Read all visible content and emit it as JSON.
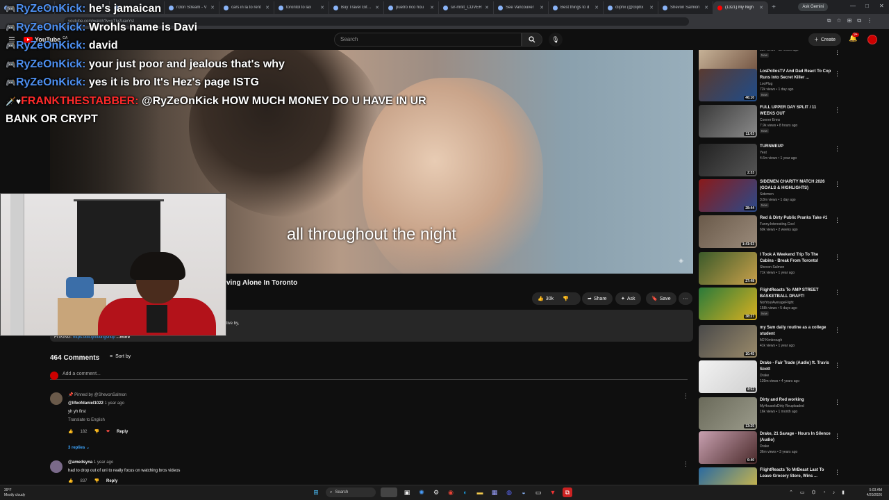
{
  "browser": {
    "tabs": [
      {
        "label": "",
        "active": false
      },
      {
        "label": "",
        "active": false
      },
      {
        "label": "",
        "active": false
      },
      {
        "label": "n3on Stream - V",
        "active": false
      },
      {
        "label": "cars in la to rent",
        "active": false
      },
      {
        "label": "torontol to lax",
        "active": false
      },
      {
        "label": "Buy Travel Gift C",
        "active": false
      },
      {
        "label": "puetro rico hou",
        "active": false
      },
      {
        "label": "sir-mrkt_COVER",
        "active": false
      },
      {
        "label": "See Vancouver",
        "active": false
      },
      {
        "label": "Best things to d",
        "active": false
      },
      {
        "label": "cliphx (@cliphx",
        "active": false
      },
      {
        "label": "Shevon Salmon",
        "active": false
      },
      {
        "label": "(1321) My Nigh",
        "active": true
      }
    ],
    "ask_gemini": "Ask Gemini",
    "url": "youtube.com/watch?v=uTIvZuaxYsl"
  },
  "youtube": {
    "logo_text": "YouTube",
    "country": "CA",
    "search_placeholder": "Search",
    "create_label": "Create",
    "notif_badge": "9+"
  },
  "chat": [
    {
      "user": "RyZeOnKick",
      "message": "he's jamaican",
      "color": "#4d8ff0",
      "prefix": "🎮"
    },
    {
      "user": "RyZeOnKick",
      "message": "Wrohls name is Davi",
      "color": "#4d8ff0",
      "prefix": "🎮"
    },
    {
      "user": "RyZeOnKick",
      "message": "david",
      "color": "#4d8ff0",
      "prefix": "🎮"
    },
    {
      "user": "RyZeOnKick",
      "message": "your just poor and jealous that's why",
      "color": "#4d8ff0",
      "prefix": "🎮"
    },
    {
      "user": "RyZeOnKick",
      "message": "yes it is bro It's Hez's page ISTG",
      "color": "#4d8ff0",
      "prefix": "🎮"
    },
    {
      "user": "FRANKTHESTABBER",
      "message": "@RyZeOnKick HOW MUCH MONEY DO U HAVE IN UR",
      "color": "#ff2a2a",
      "prefix": "🗡️♥"
    },
    {
      "user": "",
      "message": "BANK OR CRYPT",
      "color": "#ffffff",
      "prefix": ""
    }
  ],
  "player": {
    "caption": "all throughout the night"
  },
  "video": {
    "title_partial": "ving Alone In Toronto",
    "likes": "30k",
    "share_label": "Share",
    "ask_label": "Ask",
    "save_label": "Save",
    "desc_partial": "live by,",
    "desc_link_label": "FITKING:",
    "desc_link": "https://bit.ly/fitkingshop",
    "desc_more": "...more"
  },
  "comments": {
    "count_label": "464 Comments",
    "sort_label": "Sort by",
    "add_placeholder": "Add a comment...",
    "items": [
      {
        "pinned": "Pinned by @ShevonSalmon",
        "handle": "@lifeofdaniel1022",
        "time": "1 year ago",
        "body": "yh yh first",
        "translate": "Translate to English",
        "likes": "182",
        "reply": "Reply",
        "replies": "3 replies"
      },
      {
        "pinned": "",
        "handle": "@amedsyna",
        "time": "1 year ago",
        "body": "had to drop out of uni to really focus on watching bros videos",
        "translate": "",
        "likes": "837",
        "reply": "Reply",
        "replies": ""
      }
    ]
  },
  "sidebar": [
    {
      "title": "",
      "channel": "",
      "views": "38k views • 12 hours ago",
      "new": "New",
      "duration": "15:12",
      "thumb": [
        "#c9b59a",
        "#6b4b3a"
      ]
    },
    {
      "title": "LosPollosTV And Dad React To Cop Runs Into Secret Killer ...",
      "channel": "LooPlug",
      "views": "72k views • 1 day ago",
      "new": "New",
      "duration": "46:10",
      "thumb": [
        "#5a3a30",
        "#1e4c8a"
      ]
    },
    {
      "title": "FULL UPPER DAY SPLIT / 11 WEEKS OUT",
      "channel": "Conner Enns",
      "views": "7.9k views • 8 hours ago",
      "new": "New",
      "duration": "11:03",
      "thumb": [
        "#3a3a3a",
        "#8a8a8a"
      ]
    },
    {
      "title": "TURNMEUP",
      "channel": "Yeat",
      "views": "4.6m views • 1 year ago",
      "new": "",
      "duration": "2:33",
      "thumb": [
        "#222222",
        "#555555"
      ]
    },
    {
      "title": "SIDEMEN CHARITY MATCH 2026 (GOALS & HIGHLIGHTS)",
      "channel": "Sidemen",
      "views": "3.8m views • 1 day ago",
      "new": "New",
      "duration": "28:44",
      "thumb": [
        "#8a1a1a",
        "#2a4a8a"
      ]
    },
    {
      "title": "Red & Dirty Public Pranks Take #1",
      "channel": "Funny.Interesting.Cool",
      "views": "60k views • 2 weeks ago",
      "new": "",
      "duration": "1:41:03",
      "thumb": [
        "#6a5a4a",
        "#9a8a7a"
      ]
    },
    {
      "title": "I Took A Weekend Trip To The Cabins - Break From Toronto!",
      "channel": "Shevon Salmon",
      "views": "71k views • 1 year ago",
      "new": "",
      "duration": "27:48",
      "thumb": [
        "#3a5a2a",
        "#c9a04a"
      ]
    },
    {
      "title": "FlightReacts To AMP STREET BASKETBALL DRAFT!",
      "channel": "NotYourAverageFlight",
      "views": "158k views • 5 days ago",
      "new": "New",
      "duration": "38:27",
      "thumb": [
        "#2a7a3a",
        "#d8b020"
      ]
    },
    {
      "title": "my 5am daily routine as a college student",
      "channel": "MJ Kimbrough",
      "views": "41k views • 1 year ago",
      "new": "",
      "duration": "10:45",
      "thumb": [
        "#4a4a4a",
        "#9a8a6a"
      ]
    },
    {
      "title": "Drake - Fair Trade (Audio) ft. Travis Scott",
      "channel": "Drake",
      "views": "139m views • 4 years ago",
      "new": "",
      "duration": "4:52",
      "thumb": [
        "#f2f2f2",
        "#d0d0d0"
      ]
    },
    {
      "title": "Dirty and Red working",
      "channel": "MyHouseIsDirty Reuploaded",
      "views": "16k views • 1 month ago",
      "new": "",
      "duration": "13:25",
      "thumb": [
        "#6a6a5a",
        "#9a9a8a"
      ]
    },
    {
      "title": "Drake, 21 Savage - Hours In Silence (Audio)",
      "channel": "Drake",
      "views": "36m views • 3 years ago",
      "new": "",
      "duration": "6:40",
      "thumb": [
        "#c8a0b0",
        "#4a2a2a"
      ]
    },
    {
      "title": "FlightReacts To MrBeast Last To Leave Grocery Store, Wins ...",
      "channel": "",
      "views": "",
      "new": "",
      "duration": "",
      "thumb": [
        "#2a6aa0",
        "#e0c040"
      ]
    }
  ],
  "taskbar": {
    "temp": "39°F",
    "weather": "Mostly cloudy",
    "search_label": "Search",
    "time": "5:03 AM",
    "date": "4/20/2026"
  }
}
